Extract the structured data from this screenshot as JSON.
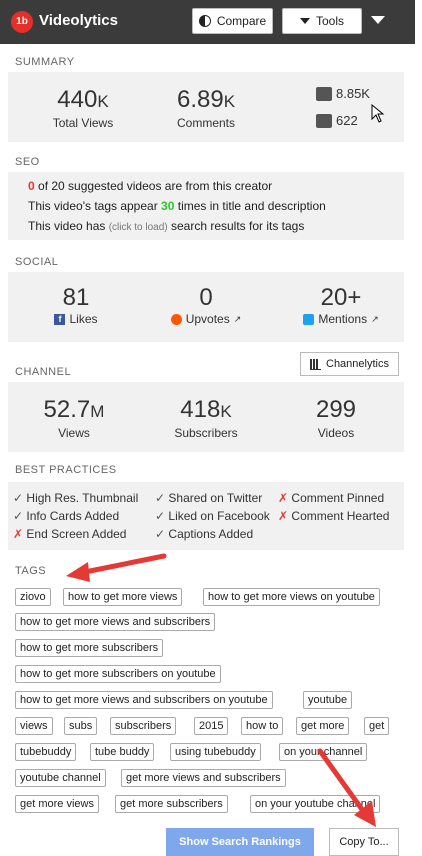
{
  "header": {
    "logo_badge": "1b",
    "app_name": "Videolytics",
    "compare_label": "Compare",
    "tools_label": "Tools"
  },
  "summary": {
    "title": "SUMMARY",
    "views_value": "440",
    "views_suffix": "K",
    "views_label": "Total Views",
    "comments_value": "6.89",
    "comments_suffix": "K",
    "comments_label": "Comments",
    "likes": "8.85K",
    "dislikes": "622"
  },
  "seo": {
    "title": "SEO",
    "line1_count": "0",
    "line1_text": "of 20 suggested videos are from this creator",
    "line2_prefix": "This video's tags appear",
    "line2_count": "30",
    "line2_suffix": "times in title and description",
    "line3_prefix": "This video has",
    "line3_link": "(click to load)",
    "line3_suffix": "search results for its tags"
  },
  "social": {
    "title": "SOCIAL",
    "likes_value": "81",
    "likes_label": "Likes",
    "upvotes_value": "0",
    "upvotes_label": "Upvotes",
    "mentions_value": "20+",
    "mentions_label": "Mentions"
  },
  "channel": {
    "title": "CHANNEL",
    "button_label": "Channelytics",
    "views_value": "52.7",
    "views_suffix": "M",
    "views_label": "Views",
    "subs_value": "418",
    "subs_suffix": "K",
    "subs_label": "Subscribers",
    "videos_value": "299",
    "videos_label": "Videos"
  },
  "best_practices": {
    "title": "BEST PRACTICES",
    "items": [
      {
        "mark": "✓",
        "label": "High Res. Thumbnail",
        "status": "ok"
      },
      {
        "mark": "✓",
        "label": "Shared on Twitter",
        "status": "ok"
      },
      {
        "mark": "✗",
        "label": "Comment Pinned",
        "status": "bad"
      },
      {
        "mark": "✓",
        "label": "Info Cards Added",
        "status": "ok"
      },
      {
        "mark": "✓",
        "label": "Liked on Facebook",
        "status": "ok"
      },
      {
        "mark": "✗",
        "label": "Comment Hearted",
        "status": "bad"
      },
      {
        "mark": "✗",
        "label": "End Screen Added",
        "status": "bad"
      },
      {
        "mark": "✓",
        "label": "Captions Added",
        "status": "ok"
      }
    ]
  },
  "tags": {
    "title": "TAGS",
    "items": [
      "ziovo",
      "how to get more views",
      "how to get more views on youtube",
      "how to get more views and subscribers",
      "how to get more subscribers",
      "how to get more subscribers on youtube",
      "how to get more views and subscribers on youtube",
      "youtube",
      "views",
      "subs",
      "subscribers",
      "2015",
      "how to",
      "get more",
      "get",
      "tubebuddy",
      "tube buddy",
      "using tubebuddy",
      "on your channel",
      "youtube channel",
      "get more views and subscribers",
      "get more views",
      "get more subscribers",
      "on your youtube channel"
    ]
  },
  "actions": {
    "rankings_label": "Show Search Rankings",
    "copy_label": "Copy To..."
  },
  "colors": {
    "header_bg": "#3b3b3b",
    "panel_bg": "#f1f1f1",
    "accent_red": "#e53935",
    "accent_green": "#2ec82e",
    "rank_button": "#7fa8ec"
  }
}
